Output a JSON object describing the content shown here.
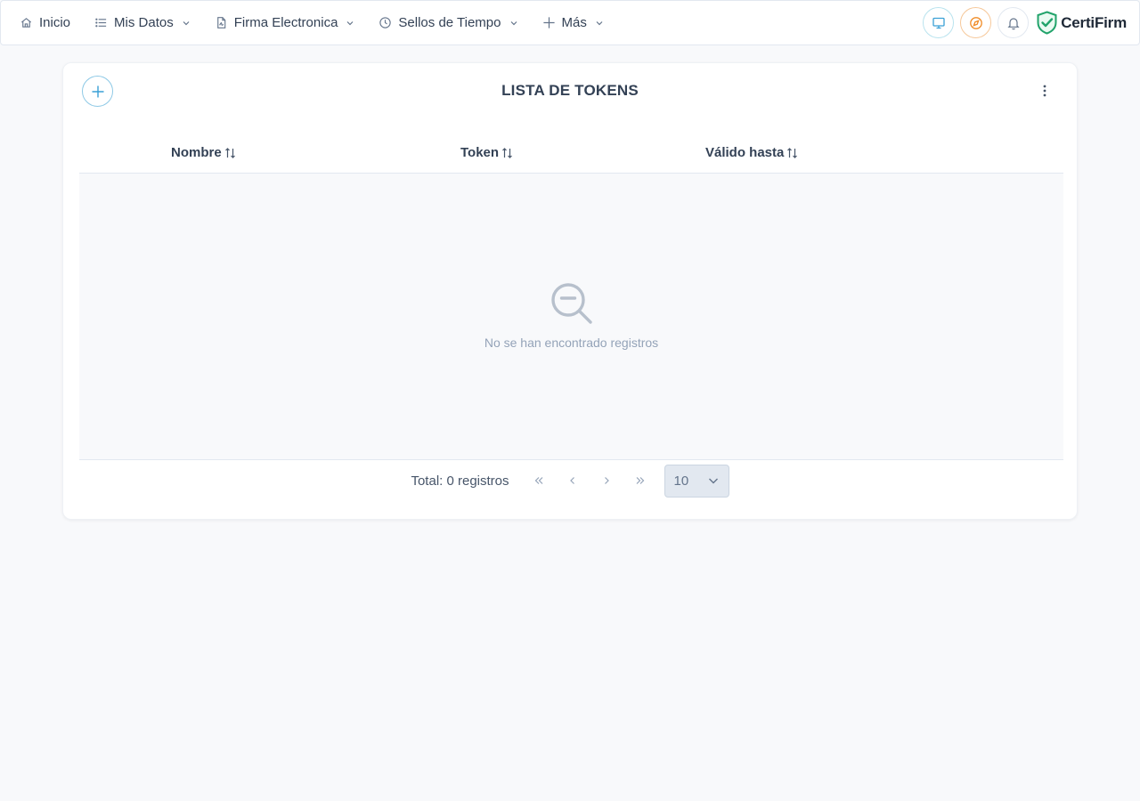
{
  "nav": {
    "items": [
      {
        "label": "Inicio",
        "icon": "home-icon",
        "dropdown": false
      },
      {
        "label": "Mis Datos",
        "icon": "list-icon",
        "dropdown": true
      },
      {
        "label": "Firma Electronica",
        "icon": "document-icon",
        "dropdown": true
      },
      {
        "label": "Sellos de Tiempo",
        "icon": "clock-icon",
        "dropdown": true
      },
      {
        "label": "Más",
        "icon": "plus-icon",
        "dropdown": true
      }
    ],
    "tools": [
      "monitor-icon",
      "compass-icon",
      "bell-icon"
    ],
    "brand": "CertiFirm"
  },
  "card": {
    "title": "LISTA DE TOKENS",
    "columns": [
      "Nombre",
      "Token",
      "Válido hasta"
    ],
    "empty_text": "No se han encontrado registros",
    "total_text": "Total: 0 registros",
    "page_size": "10"
  },
  "colors": {
    "accent": "#3aa0d6",
    "orange": "#f08a24",
    "brand_green": "#22a36b",
    "muted": "#94a3b8"
  }
}
